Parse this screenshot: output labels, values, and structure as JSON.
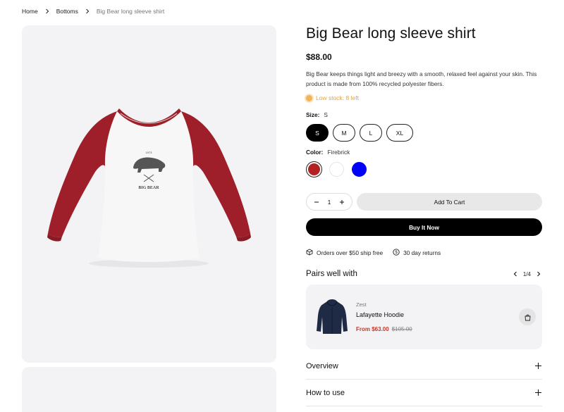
{
  "breadcrumb": {
    "items": [
      "Home",
      "Bottoms"
    ],
    "current": "Big Bear long sleeve shirt"
  },
  "product": {
    "title": "Big Bear long sleeve shirt",
    "price": "$88.00",
    "description": "Big Bear keeps things light and breezy with a smooth, relaxed feel against your skin. This product is made from 100% recycled polyester fibers.",
    "stock": "Low stock: 8 left",
    "size": {
      "label": "Size:",
      "selected": "S",
      "options": [
        "S",
        "M",
        "L",
        "XL"
      ]
    },
    "color": {
      "label": "Color:",
      "selected": "Firebrick",
      "swatches": [
        {
          "name": "Firebrick",
          "hex": "#b22222"
        },
        {
          "name": "White",
          "hex": "#ffffff"
        },
        {
          "name": "Blue",
          "hex": "#0000ff"
        }
      ]
    },
    "quantity": "1",
    "add_to_cart": "Add To Cart",
    "buy_now": "Buy It Now",
    "perks": [
      "Orders over $50 ship free",
      "30 day returns"
    ]
  },
  "pairs": {
    "title": "Pairs well with",
    "pager": "1/4",
    "item": {
      "brand": "Zest",
      "name": "Lafayette Hoodie",
      "price_sale": "From $63.00",
      "price_orig": "$105.00"
    }
  },
  "accordion": [
    "Overview",
    "How to use"
  ],
  "colors": {
    "accent": "#000000",
    "sale": "#c0392b",
    "stock": "#e0a24a",
    "panel": "#f3f2f4"
  }
}
